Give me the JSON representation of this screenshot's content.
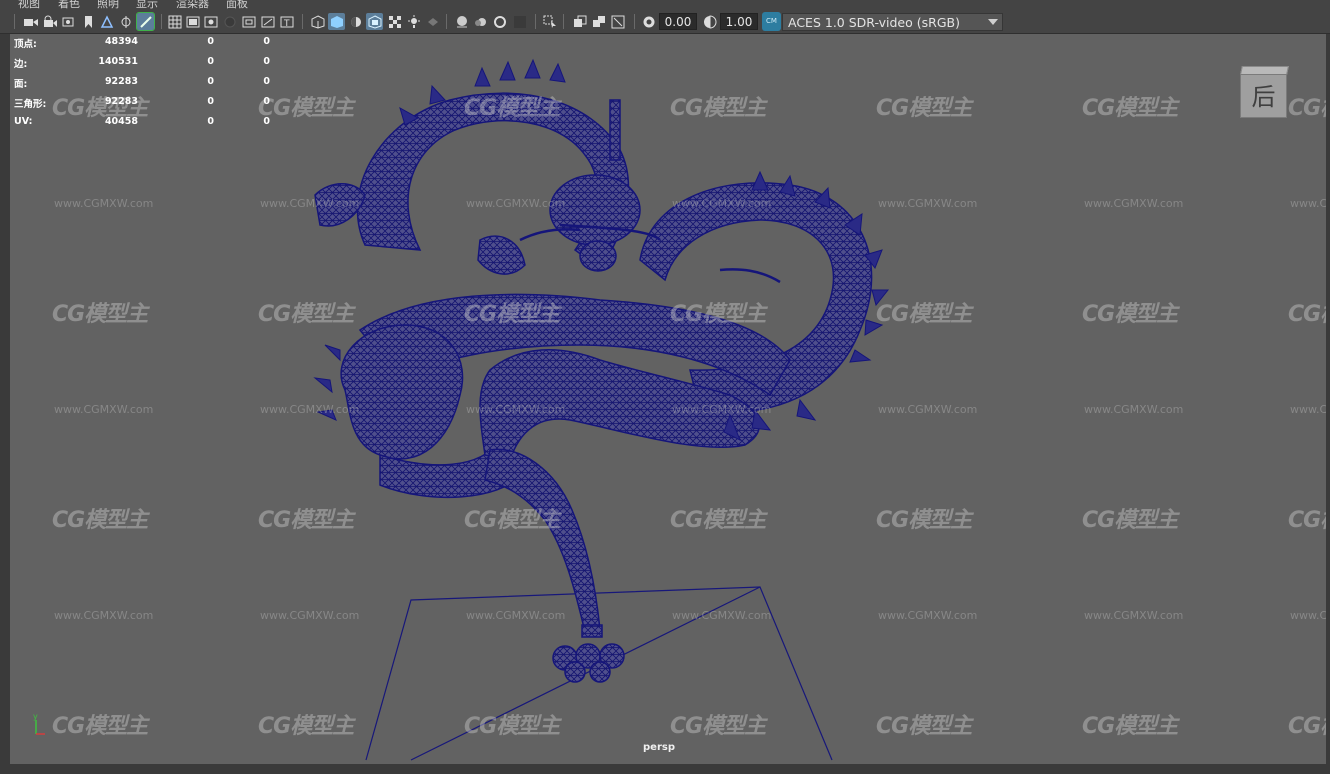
{
  "menubar": {
    "items": [
      "视图",
      "着色",
      "照明",
      "显示",
      "渲染器",
      "面板"
    ]
  },
  "toolbar": {
    "icons": [
      "camera-select-icon",
      "camera-attributes-icon",
      "bookmark-icon",
      "image-plane-icon",
      "2d-pan-zoom-icon",
      "grease-pencil-icon",
      "grid-icon",
      "film-gate-icon",
      "resolution-gate-icon",
      "gate-mask-icon",
      "field-chart-icon",
      "safe-action-icon",
      "safe-title-icon",
      "wireframe-icon",
      "smooth-shade-icon",
      "wireframe-on-shaded-icon",
      "textured-icon",
      "use-all-lights-icon",
      "shadows-icon",
      "screen-space-ao-icon",
      "motion-blur-icon",
      "anti-aliasing-icon",
      "depth-of-field-icon",
      "isolate-select-icon",
      "xray-icon",
      "xray-active-components-icon",
      "xray-joints-icon",
      "exposure-icon",
      "gamma-icon",
      "color-management-icon"
    ],
    "exposure_value": "0.00",
    "gamma_value": "1.00",
    "color_space": "ACES 1.0 SDR-video (sRGB)"
  },
  "hud": {
    "rows": [
      {
        "label": "顶点:",
        "v1": "48394",
        "v2": "0",
        "v3": "0"
      },
      {
        "label": "边:",
        "v1": "140531",
        "v2": "0",
        "v3": "0"
      },
      {
        "label": "面:",
        "v1": "92283",
        "v2": "0",
        "v3": "0"
      },
      {
        "label": "三角形:",
        "v1": "92283",
        "v2": "0",
        "v3": "0"
      },
      {
        "label": "UV:",
        "v1": "40458",
        "v2": "0",
        "v3": "0"
      }
    ]
  },
  "viewport": {
    "camera_label": "persp",
    "view_cube_label": "后",
    "axis_label": "y",
    "mesh_color": "#1a1a7e",
    "background_color": "#626262"
  },
  "watermark": {
    "logo_text": "CG模型主",
    "url_text": "www.CGMXW.com"
  }
}
